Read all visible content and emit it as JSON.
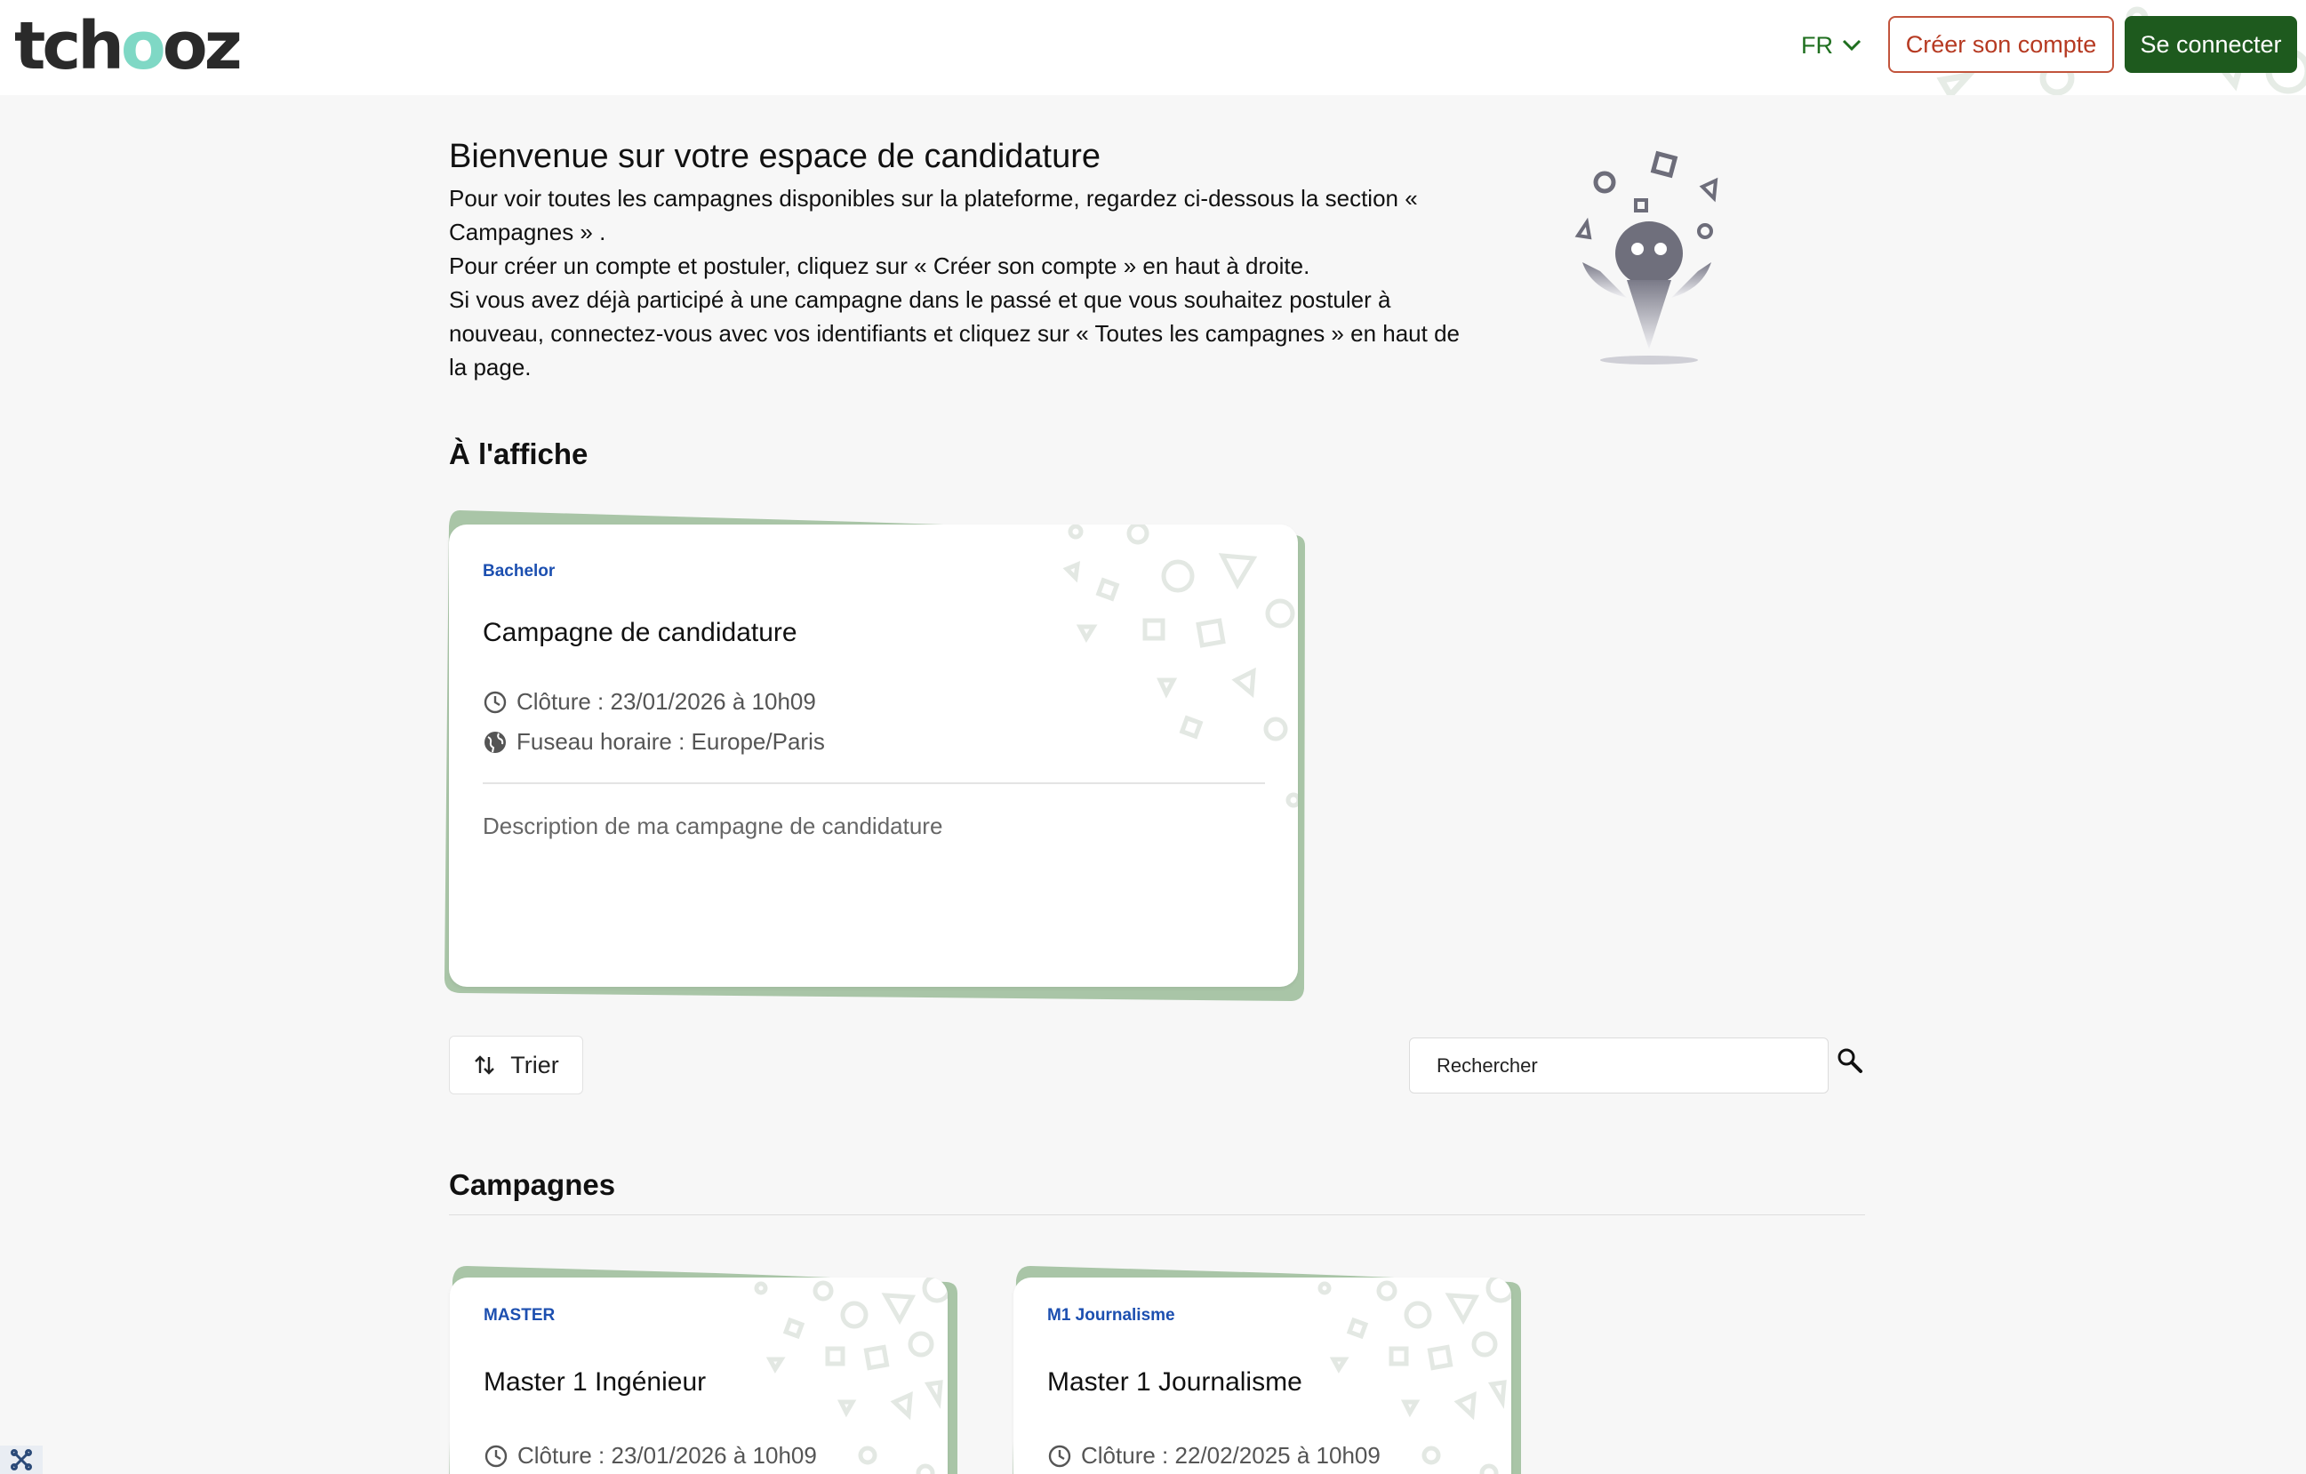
{
  "header": {
    "logo_text": "tchooz",
    "language": "FR",
    "register_label": "Créer son compte",
    "login_label": "Se connecter"
  },
  "intro": {
    "title": "Bienvenue sur votre espace de candidature",
    "lines": [
      "Pour voir toutes les campagnes disponibles sur la plateforme, regardez ci-dessous la section « Campagnes » .",
      "Pour créer un compte et postuler, cliquez sur « Créer son compte »  en haut à droite.",
      "Si vous avez déjà participé à une campagne dans le passé et que vous souhaitez postuler à nouveau, connectez-vous avec vos identifiants et cliquez sur « Toutes les campagnes » en haut de la page."
    ]
  },
  "featured": {
    "section_title": "À l'affiche",
    "card": {
      "tag": "Bachelor",
      "title": "Campagne de candidature",
      "closing": "Clôture : 23/01/2026 à 10h09",
      "timezone": "Fuseau horaire : Europe/Paris",
      "description": "Description de ma campagne de candidature"
    }
  },
  "toolbar": {
    "sort_label": "Trier",
    "search_placeholder": "Rechercher"
  },
  "campaigns": {
    "section_title": "Campagnes",
    "items": [
      {
        "tag": "MASTER",
        "title": "Master 1 Ingénieur",
        "closing": "Clôture : 23/01/2026 à 10h09"
      },
      {
        "tag": "M1 Journalisme",
        "title": "Master 1 Journalisme",
        "closing": "Clôture : 22/02/2025 à 10h09"
      }
    ]
  },
  "colors": {
    "accent_green": "#1e5a1e",
    "register_red": "#b63a22",
    "tag_blue": "#1c4fb0",
    "card_shadow_green": "#a9c5a7"
  }
}
